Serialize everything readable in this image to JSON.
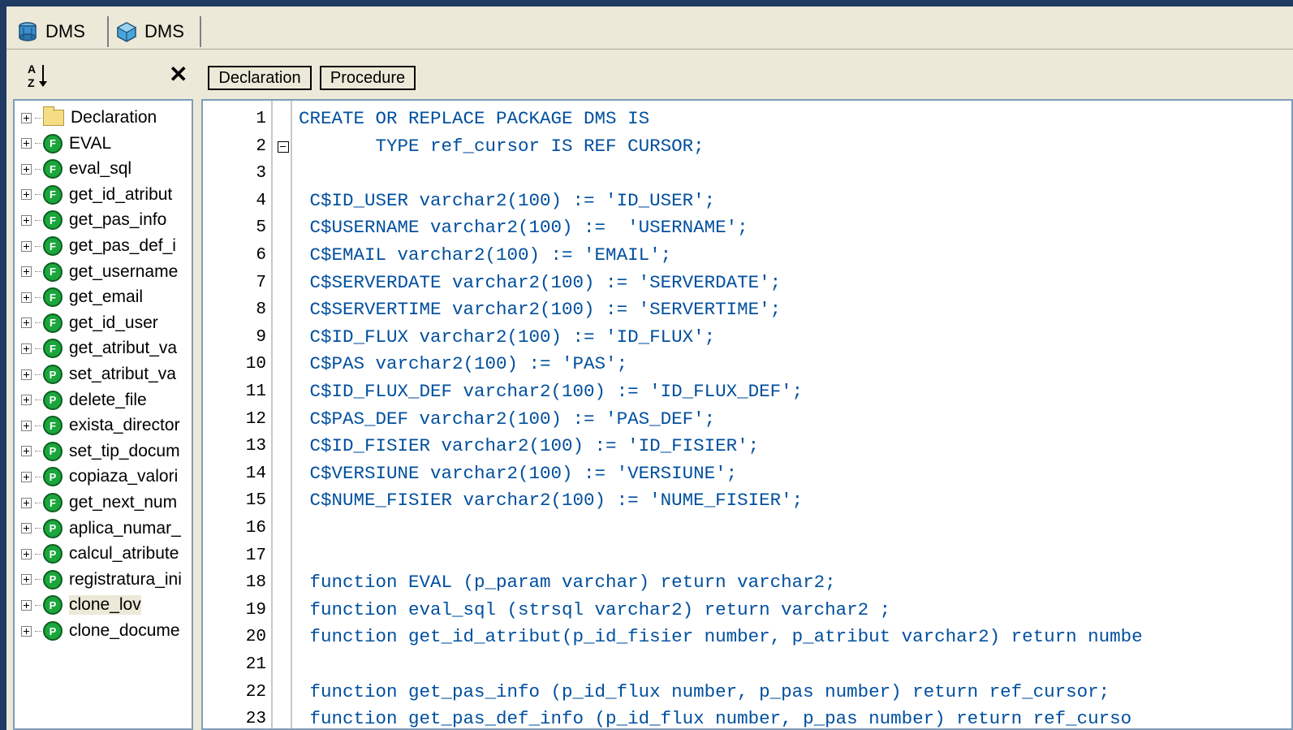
{
  "tabs": [
    {
      "label": "DMS",
      "active": true
    },
    {
      "label": "DMS",
      "active": false
    }
  ],
  "left_toolbar": {
    "sort_icon": "sort-az-icon",
    "close_label": "✕"
  },
  "editor_toolbar": {
    "declaration_label": "Declaration",
    "procedure_label": "Procedure"
  },
  "tree": {
    "items": [
      {
        "label": "Declaration",
        "type": "folder",
        "letter": ""
      },
      {
        "label": "EVAL",
        "type": "function",
        "letter": "F"
      },
      {
        "label": "eval_sql",
        "type": "function",
        "letter": "F"
      },
      {
        "label": "get_id_atribut",
        "type": "function",
        "letter": "F"
      },
      {
        "label": "get_pas_info",
        "type": "function",
        "letter": "F"
      },
      {
        "label": "get_pas_def_i",
        "type": "function",
        "letter": "F"
      },
      {
        "label": "get_username",
        "type": "function",
        "letter": "F"
      },
      {
        "label": "get_email",
        "type": "function",
        "letter": "F"
      },
      {
        "label": "get_id_user",
        "type": "function",
        "letter": "F"
      },
      {
        "label": "get_atribut_va",
        "type": "function",
        "letter": "F"
      },
      {
        "label": "set_atribut_va",
        "type": "procedure",
        "letter": "P"
      },
      {
        "label": "delete_file",
        "type": "procedure",
        "letter": "P"
      },
      {
        "label": "exista_director",
        "type": "function",
        "letter": "F"
      },
      {
        "label": "set_tip_docum",
        "type": "procedure",
        "letter": "P"
      },
      {
        "label": "copiaza_valori",
        "type": "procedure",
        "letter": "P"
      },
      {
        "label": "get_next_num",
        "type": "function",
        "letter": "F"
      },
      {
        "label": "aplica_numar_",
        "type": "procedure",
        "letter": "P"
      },
      {
        "label": "calcul_atribute",
        "type": "procedure",
        "letter": "P"
      },
      {
        "label": "registratura_ini",
        "type": "procedure",
        "letter": "P"
      },
      {
        "label": "clone_lov",
        "type": "procedure",
        "letter": "P",
        "selected": true
      },
      {
        "label": "clone_docume",
        "type": "procedure",
        "letter": "P"
      }
    ]
  },
  "editor": {
    "lines": [
      {
        "n": "1",
        "text": "CREATE OR REPLACE PACKAGE DMS IS"
      },
      {
        "n": "2",
        "text": "       TYPE ref_cursor IS REF CURSOR;",
        "fold": true
      },
      {
        "n": "3",
        "text": ""
      },
      {
        "n": "4",
        "text": " C$ID_USER varchar2(100) := 'ID_USER';"
      },
      {
        "n": "5",
        "text": " C$USERNAME varchar2(100) :=  'USERNAME';"
      },
      {
        "n": "6",
        "text": " C$EMAIL varchar2(100) := 'EMAIL';"
      },
      {
        "n": "7",
        "text": " C$SERVERDATE varchar2(100) := 'SERVERDATE';"
      },
      {
        "n": "8",
        "text": " C$SERVERTIME varchar2(100) := 'SERVERTIME';"
      },
      {
        "n": "9",
        "text": " C$ID_FLUX varchar2(100) := 'ID_FLUX';"
      },
      {
        "n": "10",
        "text": " C$PAS varchar2(100) := 'PAS';"
      },
      {
        "n": "11",
        "text": " C$ID_FLUX_DEF varchar2(100) := 'ID_FLUX_DEF';"
      },
      {
        "n": "12",
        "text": " C$PAS_DEF varchar2(100) := 'PAS_DEF';"
      },
      {
        "n": "13",
        "text": " C$ID_FISIER varchar2(100) := 'ID_FISIER';"
      },
      {
        "n": "14",
        "text": " C$VERSIUNE varchar2(100) := 'VERSIUNE';"
      },
      {
        "n": "15",
        "text": " C$NUME_FISIER varchar2(100) := 'NUME_FISIER';"
      },
      {
        "n": "16",
        "text": ""
      },
      {
        "n": "17",
        "text": ""
      },
      {
        "n": "18",
        "text": " function EVAL (p_param varchar) return varchar2;"
      },
      {
        "n": "19",
        "text": " function eval_sql (strsql varchar2) return varchar2 ;"
      },
      {
        "n": "20",
        "text": " function get_id_atribut(p_id_fisier number, p_atribut varchar2) return numbe"
      },
      {
        "n": "21",
        "text": ""
      },
      {
        "n": "22",
        "text": " function get_pas_info (p_id_flux number, p_pas number) return ref_cursor;"
      },
      {
        "n": "23",
        "text": " function get_pas_def_info (p_id_flux number, p_pas number) return ref_curso"
      }
    ]
  }
}
